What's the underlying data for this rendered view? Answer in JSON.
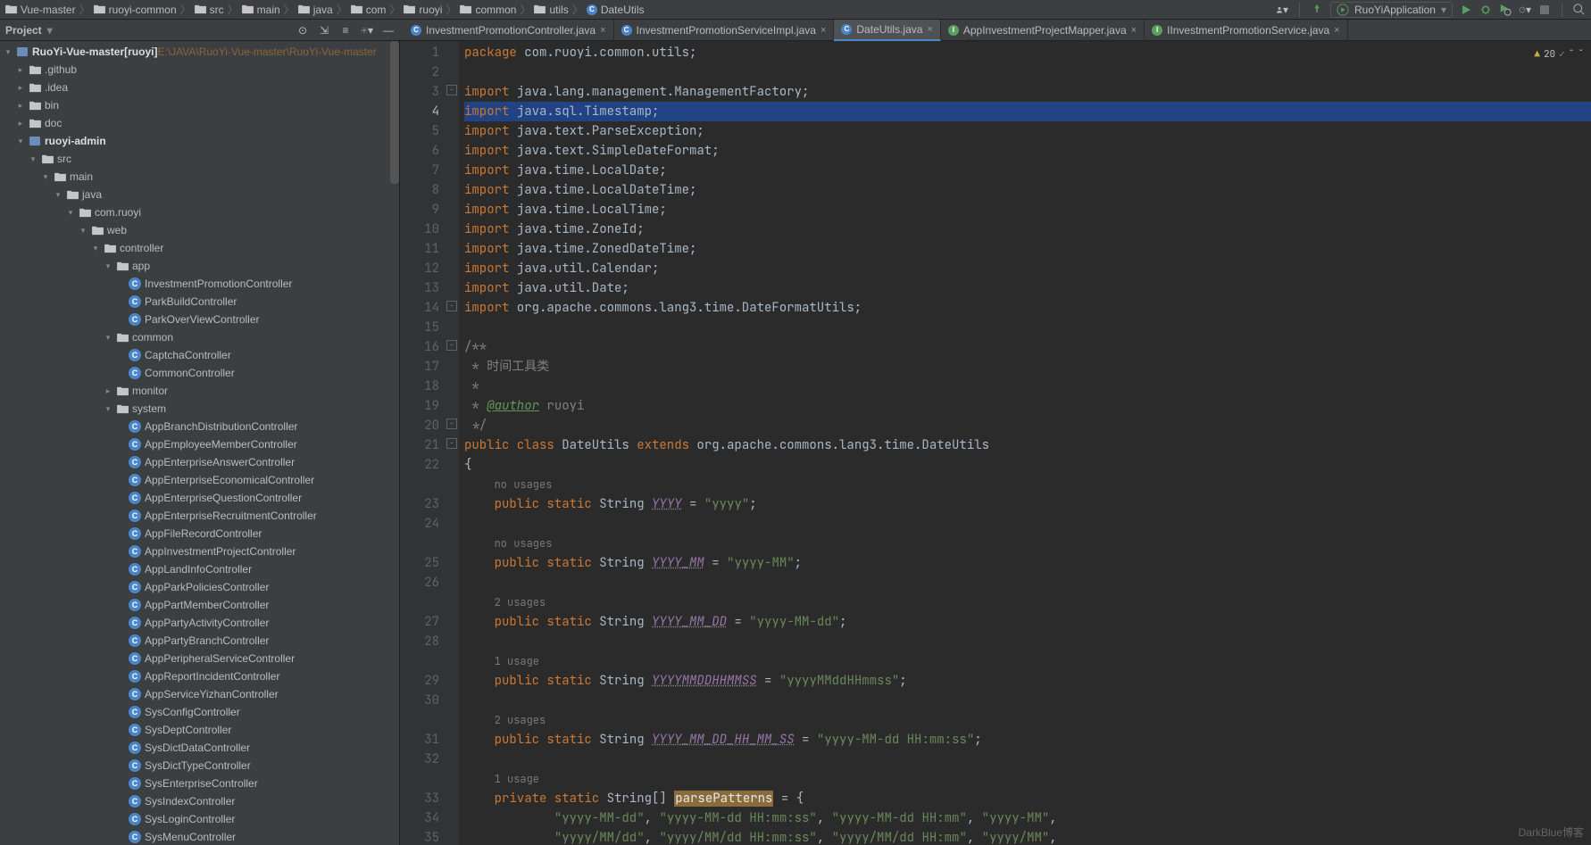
{
  "breadcrumb": [
    "Vue-master",
    "ruoyi-common",
    "src",
    "main",
    "java",
    "com",
    "ruoyi",
    "common",
    "utils",
    "DateUtils"
  ],
  "runConfig": "RuoYiApplication",
  "projectLabel": "Project",
  "tree": {
    "root": {
      "name": "RuoYi-Vue-master",
      "mod": "[ruoyi]",
      "path": "E:\\JAVA\\RuoYi-Vue-master\\RuoYi-Vue-master"
    },
    "folders": [
      ".github",
      ".idea",
      "bin",
      "doc"
    ],
    "module": "ruoyi-admin",
    "src": "src",
    "main": "main",
    "java": "java",
    "pkg": "com.ruoyi",
    "web": "web",
    "controller": "controller",
    "app": "app",
    "common": "common",
    "monitor": "monitor",
    "system": "system",
    "appCtrls": [
      "InvestmentPromotionController",
      "ParkBuildController",
      "ParkOverViewController"
    ],
    "commonCtrls": [
      "CaptchaController",
      "CommonController"
    ],
    "systemCtrls": [
      "AppBranchDistributionController",
      "AppEmployeeMemberController",
      "AppEnterpriseAnswerController",
      "AppEnterpriseEconomicalController",
      "AppEnterpriseQuestionController",
      "AppEnterpriseRecruitmentController",
      "AppFileRecordController",
      "AppInvestmentProjectController",
      "AppLandInfoController",
      "AppParkPoliciesController",
      "AppPartMemberController",
      "AppPartyActivityController",
      "AppPartyBranchController",
      "AppPeripheralServiceController",
      "AppReportIncidentController",
      "AppServiceYizhanController",
      "SysConfigController",
      "SysDeptController",
      "SysDictDataController",
      "SysDictTypeController",
      "SysEnterpriseController",
      "SysIndexController",
      "SysLoginController",
      "SysMenuController"
    ]
  },
  "tabs": [
    {
      "label": "InvestmentPromotionController.java",
      "icon": "C",
      "active": false
    },
    {
      "label": "InvestmentPromotionServiceImpl.java",
      "icon": "C",
      "active": false
    },
    {
      "label": "DateUtils.java",
      "icon": "C",
      "active": true
    },
    {
      "label": "AppInvestmentProjectMapper.java",
      "icon": "I",
      "active": false
    },
    {
      "label": "IInvestmentPromotionService.java",
      "icon": "I",
      "active": false
    }
  ],
  "inspector": {
    "warn": "20",
    "check": "✓"
  },
  "code": {
    "lines": [
      {
        "n": 1,
        "h": "<span class='kw'>package</span> com.ruoyi.common.utils;"
      },
      {
        "n": 2,
        "h": ""
      },
      {
        "n": 3,
        "h": "<span class='kw'>import</span> java.lang.management.ManagementFactory;"
      },
      {
        "n": 4,
        "h": "<span class='kw'>import</span> java.sql.Timestamp;",
        "hl": true
      },
      {
        "n": 5,
        "h": "<span class='kw'>import</span> java.text.ParseException;"
      },
      {
        "n": 6,
        "h": "<span class='kw'>import</span> java.text.SimpleDateFormat;"
      },
      {
        "n": 7,
        "h": "<span class='kw'>import</span> java.time.LocalDate;"
      },
      {
        "n": 8,
        "h": "<span class='kw'>import</span> java.time.LocalDateTime;"
      },
      {
        "n": 9,
        "h": "<span class='kw'>import</span> java.time.LocalTime;"
      },
      {
        "n": 10,
        "h": "<span class='kw'>import</span> java.time.ZoneId;"
      },
      {
        "n": 11,
        "h": "<span class='kw'>import</span> java.time.ZonedDateTime;"
      },
      {
        "n": 12,
        "h": "<span class='kw'>import</span> java.util.Calendar;"
      },
      {
        "n": 13,
        "h": "<span class='kw'>import</span> java.util.Date;"
      },
      {
        "n": 14,
        "h": "<span class='kw'>import</span> org.apache.commons.lang3.time.DateFormatUtils;"
      },
      {
        "n": 15,
        "h": ""
      },
      {
        "n": 16,
        "h": "<span class='cmt'>/**</span>"
      },
      {
        "n": 17,
        "h": "<span class='cmt'> * 时间工具类</span>"
      },
      {
        "n": 18,
        "h": "<span class='cmt'> *</span>"
      },
      {
        "n": 19,
        "h": "<span class='cmt'> * </span><span class='ctag'>@author</span><span class='cmt'> ruoyi</span>"
      },
      {
        "n": 20,
        "h": "<span class='cmt'> */</span>"
      },
      {
        "n": 21,
        "h": "<span class='kw'>public class </span>DateUtils <span class='kw'>extends</span> org.apache.commons.lang3.time.DateUtils"
      },
      {
        "n": 22,
        "h": "{"
      },
      {
        "n": "",
        "h": "    <span class='usage'>no usages</span>"
      },
      {
        "n": 23,
        "h": "    <span class='kw'>public static </span>String <span class='field u'>YYYY</span> = <span class='str'>\"yyyy\"</span>;"
      },
      {
        "n": 24,
        "h": ""
      },
      {
        "n": "",
        "h": "    <span class='usage'>no usages</span>"
      },
      {
        "n": 25,
        "h": "    <span class='kw'>public static </span>String <span class='field u'>YYYY_MM</span> = <span class='str'>\"yyyy-MM\"</span>;"
      },
      {
        "n": 26,
        "h": ""
      },
      {
        "n": "",
        "h": "    <span class='usage'>2 usages</span>"
      },
      {
        "n": 27,
        "h": "    <span class='kw'>public static </span>String <span class='field u'>YYYY_MM_DD</span> = <span class='str'>\"yyyy-MM-dd\"</span>;"
      },
      {
        "n": 28,
        "h": ""
      },
      {
        "n": "",
        "h": "    <span class='usage'>1 usage</span>"
      },
      {
        "n": 29,
        "h": "    <span class='kw'>public static </span>String <span class='field u'>YYYYMMDDHHMMSS</span> = <span class='str'>\"yyyyMMddHHmmss\"</span>;"
      },
      {
        "n": 30,
        "h": ""
      },
      {
        "n": "",
        "h": "    <span class='usage'>2 usages</span>"
      },
      {
        "n": 31,
        "h": "    <span class='kw'>public static </span>String <span class='field u'>YYYY_MM_DD_HH_MM_SS</span> = <span class='str'>\"yyyy-MM-dd HH:mm:ss\"</span>;"
      },
      {
        "n": 32,
        "h": ""
      },
      {
        "n": "",
        "h": "    <span class='usage'>1 usage</span>"
      },
      {
        "n": 33,
        "h": "    <span class='kw'>private static </span>String[] <span class='hlbox'>parsePatterns</span> = {"
      },
      {
        "n": 34,
        "h": "            <span class='str'>\"yyyy-MM-dd\"</span>, <span class='str'>\"yyyy-MM-dd HH:mm:ss\"</span>, <span class='str'>\"yyyy-MM-dd HH:mm\"</span>, <span class='str'>\"yyyy-MM\"</span>,"
      },
      {
        "n": 35,
        "h": "            <span class='str'>\"yyyy/MM/dd\"</span>, <span class='str'>\"yyyy/MM/dd HH:mm:ss\"</span>, <span class='str'>\"yyyy/MM/dd HH:mm\"</span>, <span class='str'>\"yyyy/MM\"</span>,"
      }
    ]
  },
  "watermark": "DarkBlue博客"
}
